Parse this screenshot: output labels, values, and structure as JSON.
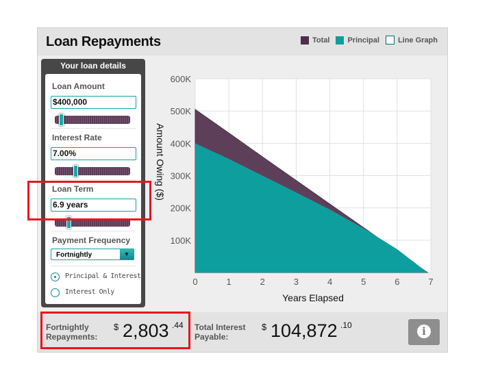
{
  "header": {
    "title": "Loan Repayments",
    "legend": [
      {
        "label": "Total",
        "color": "#4e2f4a"
      },
      {
        "label": "Principal",
        "color": "#0e9e9e"
      },
      {
        "label": "Line Graph",
        "color": "#ffffff"
      }
    ]
  },
  "details": {
    "heading": "Your loan details",
    "loan_amount": {
      "label": "Loan Amount",
      "value": "$400,000",
      "slider": 0.05
    },
    "interest_rate": {
      "label": "Interest Rate",
      "value": "7.00%",
      "slider": 0.25
    },
    "loan_term": {
      "label": "Loan Term",
      "value": "6.9 years",
      "slider": 0.17
    },
    "payment_frequency": {
      "label": "Payment Frequency",
      "selected": "Fortnightly"
    },
    "repayment_type": {
      "options": [
        "Principal & Interest",
        "Interest Only"
      ],
      "selected": "Principal & Interest"
    }
  },
  "summary": {
    "repayment_label_1": "Fortnightly",
    "repayment_label_2": "Repayments:",
    "repayment_currency": "$",
    "repayment_whole": "2,803",
    "repayment_cents": ".44",
    "interest_label_1": "Total Interest",
    "interest_label_2": "Payable:",
    "interest_currency": "$",
    "interest_whole": "104,872",
    "interest_cents": ".10",
    "info_icon": "i"
  },
  "chart_data": {
    "type": "area",
    "xlabel": "Years Elapsed",
    "ylabel": "Amount Owing ($)",
    "xlim": [
      0,
      7
    ],
    "ylim": [
      0,
      600000
    ],
    "x_ticks": [
      "0",
      "1",
      "2",
      "3",
      "4",
      "5",
      "6",
      "7"
    ],
    "y_ticks": [
      "100K",
      "200K",
      "300K",
      "400K",
      "500K",
      "600K"
    ],
    "grid": true,
    "x": [
      0,
      1,
      2,
      3,
      4,
      5,
      6,
      6.9
    ],
    "series": [
      {
        "name": "Total",
        "color": "#5e3f5a",
        "values": [
          505000,
          432000,
          358000,
          285000,
          212000,
          139000,
          66000,
          0
        ]
      },
      {
        "name": "Principal",
        "color": "#0e9e9e",
        "values": [
          400000,
          352000,
          300000,
          248000,
          195000,
          137000,
          72000,
          0
        ]
      }
    ]
  }
}
